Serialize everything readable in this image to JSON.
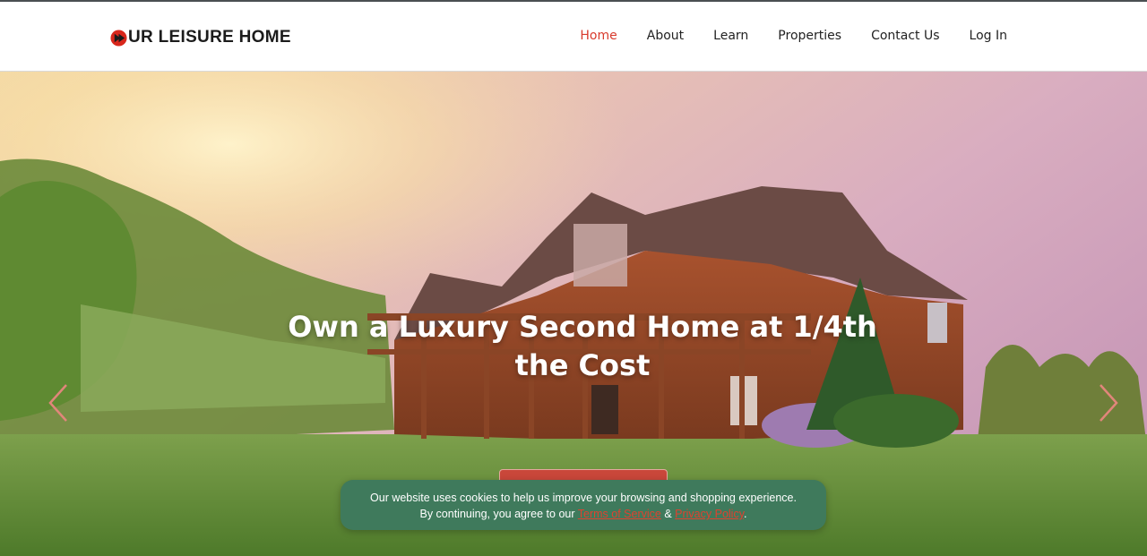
{
  "header": {
    "logo_text": "UR LEISURE HOME",
    "nav": [
      {
        "label": "Home",
        "active": true
      },
      {
        "label": "About",
        "active": false
      },
      {
        "label": "Learn",
        "active": false
      },
      {
        "label": "Properties",
        "active": false
      },
      {
        "label": "Contact Us",
        "active": false
      },
      {
        "label": "Log In",
        "active": false
      }
    ]
  },
  "hero": {
    "headline_line1": "Own a Luxury Second Home at 1/4th",
    "headline_line2": "the Cost",
    "prev_icon": "chevron-left-icon",
    "next_icon": "chevron-right-icon",
    "cta_label": ""
  },
  "cookie_banner": {
    "line1": "Our website uses cookies to help us improve your browsing and shopping experience.",
    "line2_prefix": "By continuing, you agree to our ",
    "terms_link": "Terms of Service",
    "separator": " & ",
    "privacy_link": "Privacy Policy",
    "line2_suffix": "."
  },
  "colors": {
    "accent": "#d83b2d",
    "cookie_bg": "#3f7a5c",
    "cta_bg": "#c9473a",
    "text_dark": "#222222"
  }
}
